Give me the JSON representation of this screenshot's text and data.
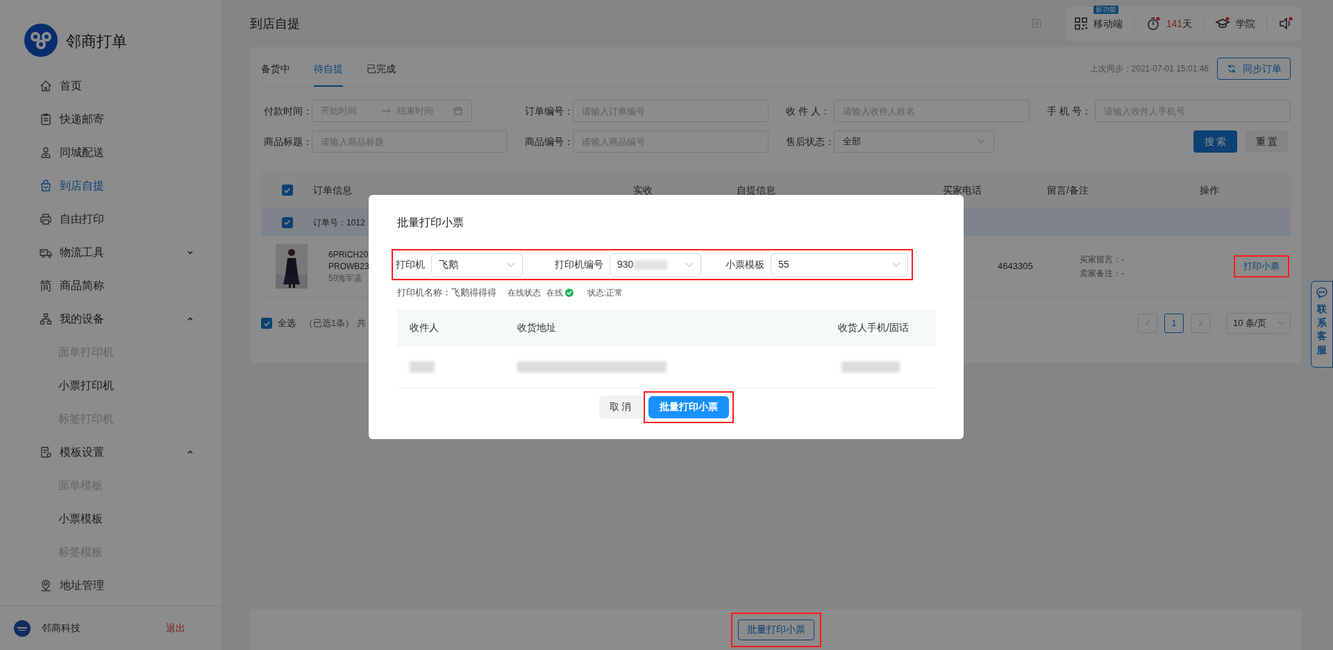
{
  "sidebar": {
    "logo_text": "邻商打单",
    "items": [
      {
        "label": "首页",
        "selected": false
      },
      {
        "label": "快递邮寄",
        "selected": false
      },
      {
        "label": "同城配送",
        "selected": false
      },
      {
        "label": "到店自提",
        "selected": true
      },
      {
        "label": "自由打印",
        "selected": false
      },
      {
        "label": "物流工具",
        "selected": false,
        "expanded": false
      },
      {
        "label": "商品简称",
        "selected": false,
        "glyph": "简"
      },
      {
        "label": "我的设备",
        "selected": false,
        "expanded": true,
        "children": [
          {
            "label": "面单打印机",
            "disabled": true
          },
          {
            "label": "小票打印机",
            "disabled": false
          },
          {
            "label": "标签打印机",
            "disabled": true
          }
        ]
      },
      {
        "label": "模板设置",
        "selected": false,
        "expanded": true,
        "children": [
          {
            "label": "面单模板",
            "disabled": true
          },
          {
            "label": "小票模板",
            "disabled": false
          },
          {
            "label": "标签模板",
            "disabled": true
          }
        ]
      },
      {
        "label": "地址管理",
        "selected": false
      }
    ],
    "company": "邻商科技",
    "logout": "退出"
  },
  "header": {
    "title": "到店自提",
    "new_badge": "新功能",
    "mobile": "移动端",
    "days_value": "141",
    "days_unit": "天",
    "academy": "学院"
  },
  "tabs": [
    {
      "label": "备货中",
      "selected": false
    },
    {
      "label": "待自提",
      "selected": true
    },
    {
      "label": "已完成",
      "selected": false
    }
  ],
  "last_sync": "上次同步：2021-07-01 15:01:46",
  "sync_button": "同步订单",
  "filters": [
    {
      "kind": "daterange",
      "label": "付款时间：",
      "start": "开始时间",
      "end": "结束时间"
    },
    {
      "kind": "text",
      "label": "订单编号：",
      "placeholder": "请输入订单编号"
    },
    {
      "kind": "text",
      "label": "收 件 人：",
      "placeholder": "请输入收件人姓名"
    },
    {
      "kind": "text",
      "label": "手 机 号：",
      "placeholder": "请输入收件人手机号"
    },
    {
      "kind": "text",
      "label": "商品标题：",
      "placeholder": "请输入商品标题"
    },
    {
      "kind": "text",
      "label": "商品编号：",
      "placeholder": "请输入商品编号"
    },
    {
      "kind": "select",
      "label": "售后状态：",
      "value": "全部"
    }
  ],
  "search_button": "搜 索",
  "reset_button": "重 置",
  "table": {
    "columns": [
      "订单信息",
      "实收",
      "自提信息",
      "买家电话",
      "留言/备注",
      "操作"
    ],
    "header_checked": true,
    "order": {
      "checked": true,
      "number": "订单号：1012"
    },
    "product": {
      "lines": [
        "6PRICH20",
        "PROWB23",
        "59海军蓝"
      ],
      "phone": "4643305",
      "buyer_note": "买家留言：-",
      "seller_note": "卖家备注：-",
      "action": "打印小票",
      "action_highlighted": true
    }
  },
  "footer": {
    "select_all": "全选",
    "all_checked": true,
    "summary": "（已选1条） 共",
    "pages": [
      {
        "label": "1",
        "selected": true
      }
    ],
    "page_size": "10 条/页"
  },
  "contact": "联系客服",
  "bottom": {
    "button": "批量打印小票",
    "highlighted": true
  },
  "dialog": {
    "title": "批量打印小票",
    "fields_highlighted": true,
    "fields": [
      {
        "label": "打印机",
        "value": "飞鹅"
      },
      {
        "label": "打印机编号",
        "value": "930",
        "blurred": true
      },
      {
        "label": "小票模板",
        "value": "55"
      }
    ],
    "printer_name": "打印机名称：飞鹅得得得",
    "online_label": "在线状态",
    "online": "在线",
    "online_ok": true,
    "status": "状态:正常",
    "columns": [
      "收件人",
      "收货地址",
      "收货人手机/固话"
    ],
    "cancel": "取 消",
    "confirm": "批量打印小票",
    "confirm_highlighted": true
  }
}
